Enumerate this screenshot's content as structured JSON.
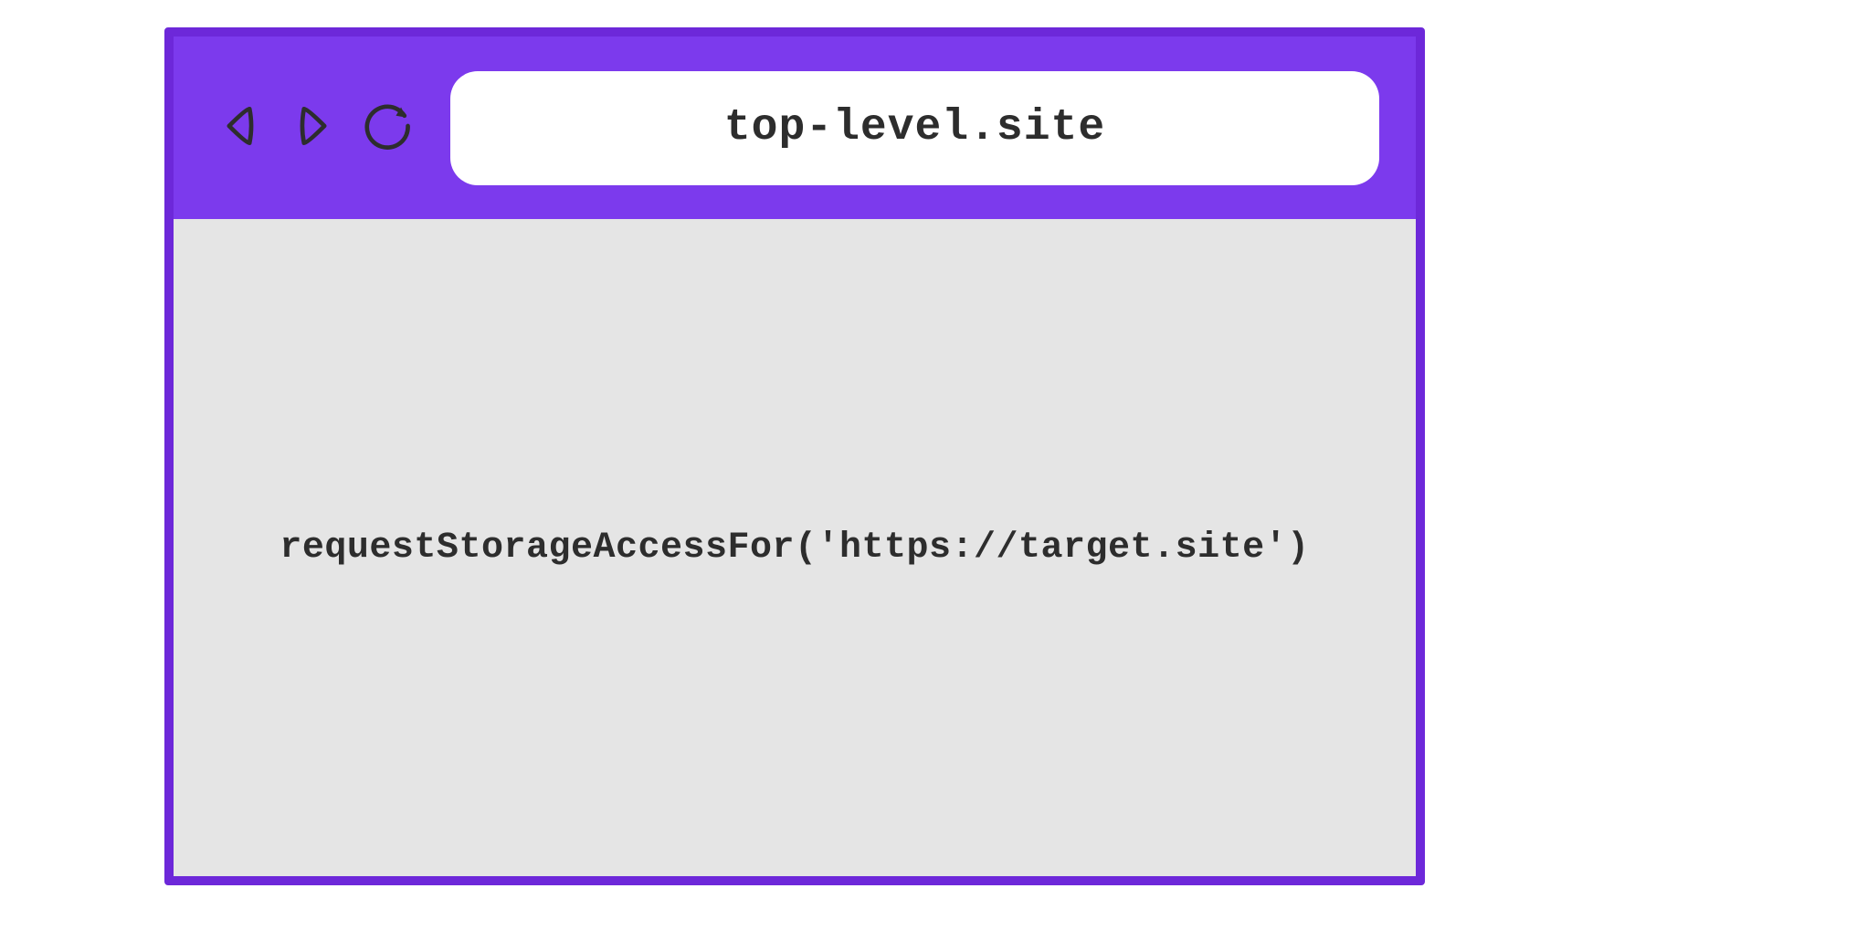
{
  "browser": {
    "address": "top-level.site",
    "content": {
      "code": "requestStorageAccessFor('https://target.site')"
    }
  },
  "colors": {
    "primary": "#7c3aed",
    "border": "#6d28d9",
    "content_bg": "#e5e5e5",
    "text": "#2d2d2d"
  }
}
